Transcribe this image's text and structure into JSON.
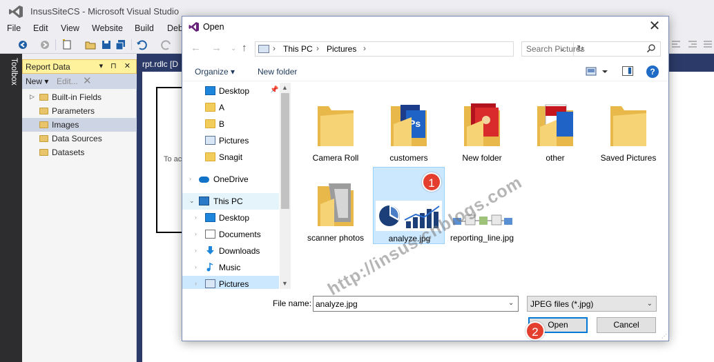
{
  "vs": {
    "title": "InsusSiteCS - Microsoft Visual Studio",
    "menu": [
      "File",
      "Edit",
      "View",
      "Website",
      "Build",
      "Debu"
    ],
    "toolbox_label": "Toolbox",
    "doc_tab": "rpt.rdlc [D",
    "canvas_text": "To ac"
  },
  "report_data": {
    "title": "Report Data",
    "new_label": "New",
    "edit_label": "Edit...",
    "items": [
      {
        "label": "Built-in Fields",
        "expandable": true
      },
      {
        "label": "Parameters",
        "expandable": false
      },
      {
        "label": "Images",
        "expandable": false,
        "selected": true
      },
      {
        "label": "Data Sources",
        "expandable": false
      },
      {
        "label": "Datasets",
        "expandable": false
      }
    ]
  },
  "dialog": {
    "title": "Open",
    "breadcrumb": [
      "This PC",
      "Pictures"
    ],
    "search_placeholder": "Search Pictures",
    "organize_label": "Organize",
    "new_folder_label": "New folder",
    "nav_items": [
      {
        "label": "Desktop",
        "icon": "desktop",
        "indent": 1,
        "pinned": true
      },
      {
        "label": "A",
        "icon": "folder",
        "indent": 1
      },
      {
        "label": "B",
        "icon": "folder",
        "indent": 1
      },
      {
        "label": "Pictures",
        "icon": "pictures",
        "indent": 1
      },
      {
        "label": "Snagit",
        "icon": "folder",
        "indent": 1
      },
      {
        "label": "OneDrive",
        "icon": "cloud",
        "indent": 0
      },
      {
        "label": "This PC",
        "icon": "pc",
        "indent": 0,
        "expanded": true
      },
      {
        "label": "Desktop",
        "icon": "desktop",
        "indent": 1
      },
      {
        "label": "Documents",
        "icon": "documents",
        "indent": 1
      },
      {
        "label": "Downloads",
        "icon": "downloads",
        "indent": 1
      },
      {
        "label": "Music",
        "icon": "music",
        "indent": 1
      },
      {
        "label": "Pictures",
        "icon": "pictures",
        "indent": 1,
        "selected": true
      }
    ],
    "files": [
      {
        "label": "Camera Roll",
        "kind": "folder"
      },
      {
        "label": "customers",
        "kind": "folder-ps"
      },
      {
        "label": "New folder",
        "kind": "folder-red"
      },
      {
        "label": "other",
        "kind": "folder-other"
      },
      {
        "label": "Saved Pictures",
        "kind": "folder"
      },
      {
        "label": "scanner photos",
        "kind": "folder-scanner"
      },
      {
        "label": "analyze.jpg",
        "kind": "image-chart",
        "selected": true
      },
      {
        "label": "reporting_line.jpg",
        "kind": "image-flow"
      }
    ],
    "file_name_label": "File name:",
    "file_name_value": "analyze.jpg",
    "file_type": "JPEG files (*.jpg)",
    "open_label": "Open",
    "cancel_label": "Cancel"
  },
  "annotations": {
    "badge1": "1",
    "badge2": "2",
    "watermark": "http://insus.cnblogs.com"
  },
  "colors": {
    "vs_dark": "#2d2d30",
    "doc_bar": "#2b3a68",
    "selection": "#cce8ff",
    "badge": "#e43e2f",
    "accent": "#0078d7"
  }
}
